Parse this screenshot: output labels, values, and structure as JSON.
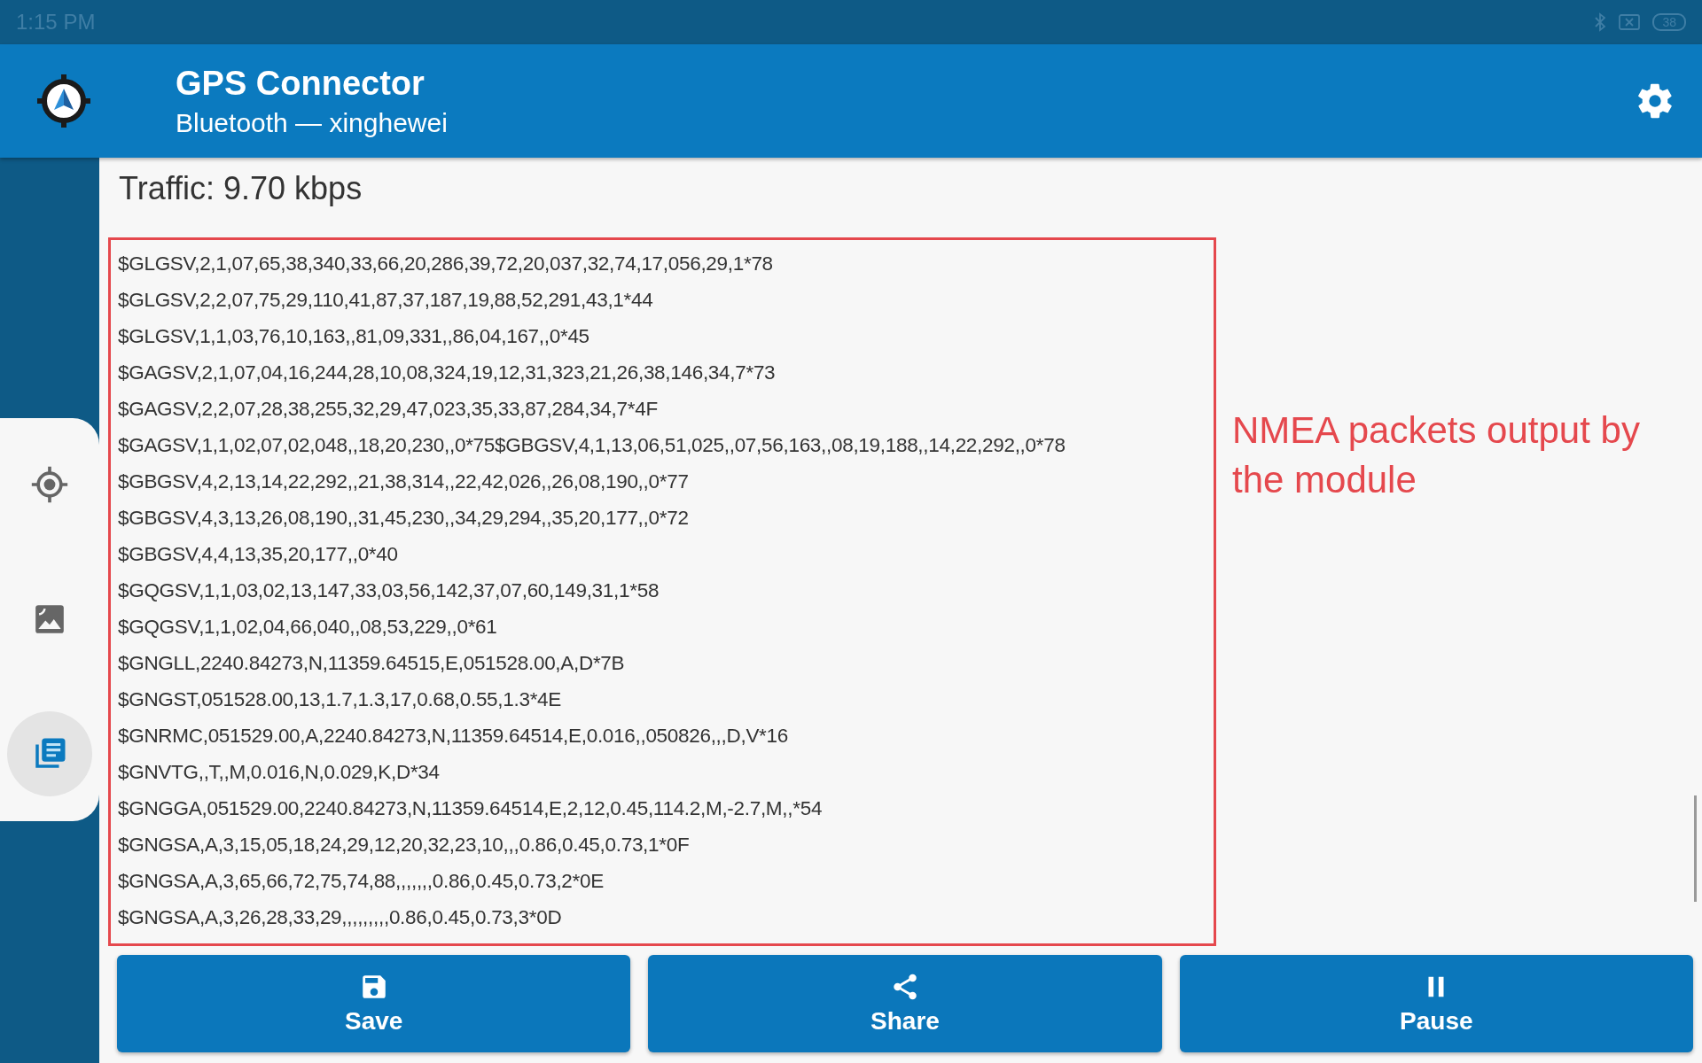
{
  "status_bar": {
    "time": "1:15 PM",
    "battery": "38"
  },
  "app_bar": {
    "title": "GPS Connector",
    "subtitle": "Bluetooth — xinghewei"
  },
  "sidebar": {
    "items": [
      {
        "selected": false
      },
      {
        "selected": false
      },
      {
        "selected": true
      }
    ]
  },
  "traffic": "Traffic: 9.70 kbps",
  "log": {
    "lines": [
      "$GLGSV,2,1,07,65,38,340,33,66,20,286,39,72,20,037,32,74,17,056,29,1*78",
      "$GLGSV,2,2,07,75,29,110,41,87,37,187,19,88,52,291,43,1*44",
      "$GLGSV,1,1,03,76,10,163,,81,09,331,,86,04,167,,0*45",
      "$GAGSV,2,1,07,04,16,244,28,10,08,324,19,12,31,323,21,26,38,146,34,7*73",
      "$GAGSV,2,2,07,28,38,255,32,29,47,023,35,33,87,284,34,7*4F",
      "$GAGSV,1,1,02,07,02,048,,18,20,230,,0*75$GBGSV,4,1,13,06,51,025,,07,56,163,,08,19,188,,14,22,292,,0*78",
      "$GBGSV,4,2,13,14,22,292,,21,38,314,,22,42,026,,26,08,190,,0*77",
      "$GBGSV,4,3,13,26,08,190,,31,45,230,,34,29,294,,35,20,177,,0*72",
      "$GBGSV,4,4,13,35,20,177,,0*40",
      "$GQGSV,1,1,03,02,13,147,33,03,56,142,37,07,60,149,31,1*58",
      "$GQGSV,1,1,02,04,66,040,,08,53,229,,0*61",
      "$GNGLL,2240.84273,N,11359.64515,E,051528.00,A,D*7B",
      "$GNGST,051528.00,13,1.7,1.3,17,0.68,0.55,1.3*4E",
      "$GNRMC,051529.00,A,2240.84273,N,11359.64514,E,0.016,,050826,,,D,V*16",
      "$GNVTG,,T,,M,0.016,N,0.029,K,D*34",
      "$GNGGA,051529.00,2240.84273,N,11359.64514,E,2,12,0.45,114.2,M,-2.7,M,,*54",
      "$GNGSA,A,3,15,05,18,24,29,12,20,32,23,10,,,0.86,0.45,0.73,1*0F",
      "$GNGSA,A,3,65,66,72,75,74,88,,,,,,,0.86,0.45,0.73,2*0E",
      "$GNGSA,A,3,26,28,33,29,,,,,,,,,0.86,0.45,0.73,3*0D"
    ]
  },
  "annotation": "NMEA packets output by the module",
  "buttons": [
    {
      "label": "Save"
    },
    {
      "label": "Share"
    },
    {
      "label": "Pause"
    }
  ]
}
